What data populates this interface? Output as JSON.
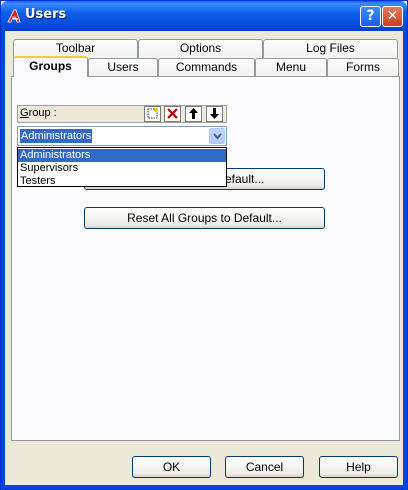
{
  "window": {
    "title": "Users",
    "help_label": "?",
    "close_label": "✕"
  },
  "tabs": {
    "row1": [
      {
        "label": "Toolbar"
      },
      {
        "label": "Options"
      },
      {
        "label": "Log Files"
      }
    ],
    "row2": [
      {
        "label": "Groups",
        "active": true
      },
      {
        "label": "Users"
      },
      {
        "label": "Commands"
      },
      {
        "label": "Menu"
      },
      {
        "label": "Forms"
      }
    ]
  },
  "groups_panel": {
    "group_label": "Group :",
    "toolbar_icons": [
      "new-icon",
      "delete-icon",
      "move-up-icon",
      "move-down-icon"
    ],
    "combo_value": "Administrators",
    "dropdown_options": [
      "Administrators",
      "Supervisors",
      "Testers"
    ],
    "reset_group_label": "...efault...",
    "reset_group_visible_text": "efault...",
    "reset_all_label": "Reset All Groups to Default..."
  },
  "footer": {
    "ok_label": "OK",
    "cancel_label": "Cancel",
    "help_label": "Help"
  },
  "colors": {
    "titlebar": "#0646d6",
    "selection": "#316ac5",
    "active_tab_accent": "#ffc73c",
    "dialog_bg": "#ece9d8"
  }
}
